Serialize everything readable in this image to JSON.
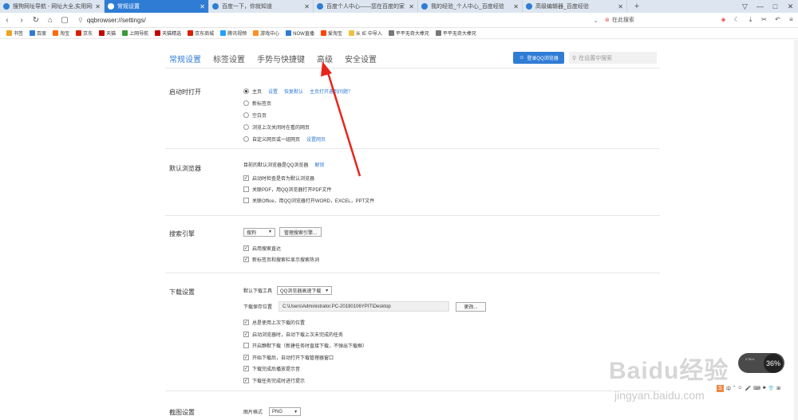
{
  "tabs": [
    {
      "title": "搜狗网址导航 - 网址大全,实用网址",
      "active": false
    },
    {
      "title": "常规设置",
      "active": true
    },
    {
      "title": "百度一下，你就知道",
      "active": false
    },
    {
      "title": "百度个人中心——您在百度的家",
      "active": false
    },
    {
      "title": "我的经验_个人中心_百度经验",
      "active": false
    },
    {
      "title": "高级编辑器_百度经验",
      "active": false
    }
  ],
  "new_tab": "+",
  "window_controls": [
    "▽",
    "—",
    "□",
    "✕"
  ],
  "address": {
    "url": "qqbrowser://settings/",
    "search_label": "在此搜索"
  },
  "nav_icons": [
    "back-icon",
    "forward-icon",
    "reload-icon",
    "home-icon",
    "tabs-icon"
  ],
  "nav_right_icons": [
    "gamepad-icon",
    "moon-icon",
    "download-icon",
    "cut-icon",
    "undo-icon",
    "menu-icon"
  ],
  "bookmarks": [
    {
      "label": "书签",
      "color": "#f0a020"
    },
    {
      "label": "百度",
      "color": "#2f7cd5"
    },
    {
      "label": "淘宝",
      "color": "#ff6a00"
    },
    {
      "label": "京东",
      "color": "#d81e06"
    },
    {
      "label": "天猫",
      "color": "#c40000"
    },
    {
      "label": "上网导航",
      "color": "#3a9a3a"
    },
    {
      "label": "天猫精选",
      "color": "#c40000"
    },
    {
      "label": "京东商城",
      "color": "#d81e06"
    },
    {
      "label": "腾讯视频",
      "color": "#20a0ff"
    },
    {
      "label": "游戏中心",
      "color": "#ff9020"
    },
    {
      "label": "NOW直播",
      "color": "#2f7cd5"
    },
    {
      "label": "爱淘宝",
      "color": "#ff4400"
    },
    {
      "label": "从 IE 中导入",
      "color": "#f0c040"
    },
    {
      "label": "平平无奇大棒兄",
      "color": "#777777"
    },
    {
      "label": "平平无奇大棒兄",
      "color": "#777777"
    }
  ],
  "settings": {
    "tabs": [
      "常规设置",
      "标签设置",
      "手势与快捷键",
      "高级",
      "安全设置"
    ],
    "active_tab": 0,
    "login_label": "登录QQ浏览器",
    "search_placeholder": "在设置中搜索"
  },
  "startup": {
    "title": "启动时打开",
    "options": [
      {
        "label": "主页",
        "checked": true,
        "links": [
          "设置",
          "恢复默认",
          "主页打开遇到问题？"
        ]
      },
      {
        "label": "新标签页",
        "checked": false,
        "links": []
      },
      {
        "label": "空白页",
        "checked": false,
        "links": []
      },
      {
        "label": "浏览上次关闭时在看的网页",
        "checked": false,
        "links": []
      },
      {
        "label": "自定义网页或一组网页",
        "checked": false,
        "links": [
          "设置网页"
        ]
      }
    ]
  },
  "default_browser": {
    "title": "默认浏览器",
    "status": "目前的默认浏览器是QQ浏览器",
    "status_link": "解锁",
    "options": [
      {
        "label": "启动时检查是否为默认浏览器",
        "checked": true
      },
      {
        "label": "关联PDF，用QQ浏览器打开PDF文件",
        "checked": false
      },
      {
        "label": "关联Office，用QQ浏览器打开WORD，EXCEL，PPT文件",
        "checked": false
      }
    ]
  },
  "search_engine": {
    "title": "搜索引擎",
    "selected": "搜狗",
    "manage_label": "管理搜索引擎...",
    "options": [
      {
        "label": "启用搜索直达",
        "checked": true
      },
      {
        "label": "新标签页和搜索栏显示搜索热词",
        "checked": true
      }
    ]
  },
  "download": {
    "title": "下载设置",
    "tool_label": "默认下载工具",
    "tool_selected": "QQ浏览器高速下载",
    "path_label": "下载保存位置",
    "path_value": "C:\\Users\\Administrator.PC-20190106YPIT\\Desktop",
    "change_label": "更改...",
    "options": [
      {
        "label": "总是使用上次下载的位置",
        "checked": true
      },
      {
        "label": "启动浏览器时，自动下载上次未完成的任务",
        "checked": true
      },
      {
        "label": "开启静默下载（新建任务时直接下载，不弹出下载框）",
        "checked": false
      },
      {
        "label": "开始下载后，自动打开下载管理器窗口",
        "checked": true
      },
      {
        "label": "下载完成后播放提示音",
        "checked": true
      },
      {
        "label": "下载任务完成时进行提示",
        "checked": true
      }
    ]
  },
  "screenshot": {
    "title": "截图设置",
    "format_label": "图片格式",
    "format_value": "PNG"
  },
  "watermark": {
    "brand": "Baidu经验",
    "url": "jingyan.baidu.com"
  },
  "speed_badge": {
    "value": "36%",
    "label": "0.3K/s"
  },
  "ime_bar": {
    "logo": "S",
    "items": [
      "中",
      "°",
      "☺",
      "🎤",
      "⌨",
      "♣",
      "👕",
      "⊞"
    ]
  }
}
